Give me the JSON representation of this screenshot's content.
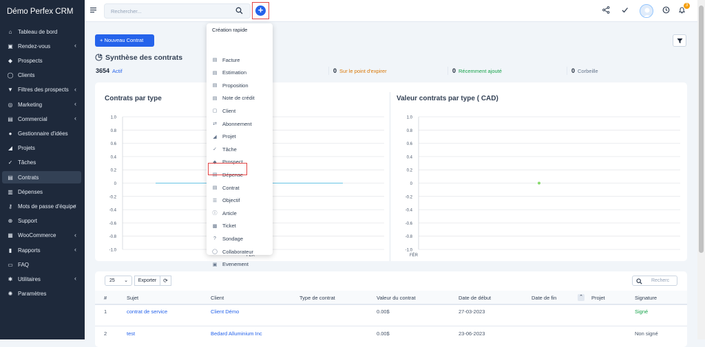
{
  "app": {
    "brand": "Démo Perfex CRM"
  },
  "sidebar": {
    "items": [
      {
        "label": "Tableau de bord",
        "icon": "home-icon",
        "chevron": false
      },
      {
        "label": "Rendez-vous",
        "icon": "calendar-icon",
        "chevron": true
      },
      {
        "label": "Prospects",
        "icon": "tag-icon",
        "chevron": false
      },
      {
        "label": "Clients",
        "icon": "user-icon",
        "chevron": false
      },
      {
        "label": "Filtres des prospects",
        "icon": "filter-icon",
        "chevron": true
      },
      {
        "label": "Marketing",
        "icon": "target-icon",
        "chevron": true
      },
      {
        "label": "Commercial",
        "icon": "box-icon",
        "chevron": true
      },
      {
        "label": "Gestionnaire d'idées",
        "icon": "bulb-icon",
        "chevron": false
      },
      {
        "label": "Projets",
        "icon": "chart-icon",
        "chevron": false
      },
      {
        "label": "Tâches",
        "icon": "check-circle-icon",
        "chevron": false
      },
      {
        "label": "Contrats",
        "icon": "document-icon",
        "chevron": false
      },
      {
        "label": "Dépenses",
        "icon": "receipt-icon",
        "chevron": false
      },
      {
        "label": "Mots de passe d'équipe",
        "icon": "key-icon",
        "chevron": true
      },
      {
        "label": "Support",
        "icon": "lifebuoy-icon",
        "chevron": false
      },
      {
        "label": "WooCommerce",
        "icon": "cart-icon",
        "chevron": true
      },
      {
        "label": "Rapports",
        "icon": "chart-bar-icon",
        "chevron": true
      },
      {
        "label": "FAQ",
        "icon": "folder-icon",
        "chevron": false
      },
      {
        "label": "Utilitaires",
        "icon": "cogs-icon",
        "chevron": true
      },
      {
        "label": "Paramètres",
        "icon": "gear-icon",
        "chevron": false
      }
    ]
  },
  "topbar": {
    "search_placeholder": "Rechercher...",
    "notification_count": "3"
  },
  "page": {
    "new_contract": "+ Nouveau Contrat",
    "summary_title": "Synthèse des contrats",
    "stats": [
      {
        "value": "3654",
        "label": "Actif",
        "color": "#2563eb"
      },
      {
        "value": "0",
        "label": "Sur le point d'expirer",
        "color": "#d97706"
      },
      {
        "value": "0",
        "label": "Récemment ajouté",
        "color": "#16a34a"
      },
      {
        "value": "0",
        "label": "Corbeille",
        "color": "#64748b"
      }
    ]
  },
  "chart_data": [
    {
      "type": "line",
      "title": "Contrats par type",
      "x": [
        "FÉR"
      ],
      "ylim": [
        -1.0,
        1.0
      ],
      "yticks": [
        "1.0",
        "0.8",
        "0.6",
        "0.4",
        "0.2",
        "0",
        "-0.2",
        "-0.4",
        "-0.6",
        "-0.8",
        "-1.0"
      ],
      "series": [
        {
          "values": [
            0
          ]
        }
      ]
    },
    {
      "type": "line",
      "title": "Valeur contrats par type ( CAD)",
      "x": [
        "FÉR"
      ],
      "ylim": [
        -1.0,
        1.0
      ],
      "yticks": [
        "1.0",
        "0.8",
        "0.6",
        "0.4",
        "0.2",
        "0",
        "-0.2",
        "-0.4",
        "-0.6",
        "-0.8",
        "-1.0"
      ],
      "series": [
        {
          "values": [
            0
          ]
        }
      ]
    }
  ],
  "table": {
    "page_size": "25",
    "export": "Exporter",
    "search_placeholder": "Recherc",
    "headers": [
      "#",
      "Sujet",
      "Client",
      "Type de contrat",
      "Valeur du contrat",
      "Date de début",
      "Date de fin",
      "Projet",
      "Signature"
    ],
    "rows": [
      {
        "num": "1",
        "subject": "contrat de service",
        "client": "Client Démo",
        "type": "",
        "value": "0.00$",
        "start": "27-03-2023",
        "end": "",
        "project": "",
        "signature": "Signé"
      },
      {
        "num": "2",
        "subject": "test",
        "client": "Bedard Alluminium Inc",
        "type": "",
        "value": "0.00$",
        "start": "23-06-2023",
        "end": "",
        "project": "",
        "signature": "Non signé"
      }
    ]
  },
  "quick_create": {
    "title": "Création rapide",
    "items": [
      {
        "label": "Facture",
        "icon": "file-icon"
      },
      {
        "label": "Estimation",
        "icon": "file-icon"
      },
      {
        "label": "Proposition",
        "icon": "file-icon"
      },
      {
        "label": "Note de crédit",
        "icon": "file-icon"
      },
      {
        "label": "Client",
        "icon": "id-card-icon"
      },
      {
        "label": "Abonnement",
        "icon": "repeat-icon"
      },
      {
        "label": "Projet",
        "icon": "chart-icon"
      },
      {
        "label": "Tâche",
        "icon": "check-circle-icon"
      },
      {
        "label": "Prospect",
        "icon": "tag-icon"
      },
      {
        "label": "Dépense",
        "icon": "file-icon"
      },
      {
        "label": "Contrat",
        "icon": "file-icon"
      },
      {
        "label": "Objectif",
        "icon": "list-icon"
      },
      {
        "label": "Article",
        "icon": "info-icon"
      },
      {
        "label": "Ticket",
        "icon": "ticket-icon"
      },
      {
        "label": "Sondage",
        "icon": "question-icon"
      },
      {
        "label": "Collaborateur",
        "icon": "user-icon"
      },
      {
        "label": "Evenement",
        "icon": "calendar-icon"
      }
    ]
  }
}
